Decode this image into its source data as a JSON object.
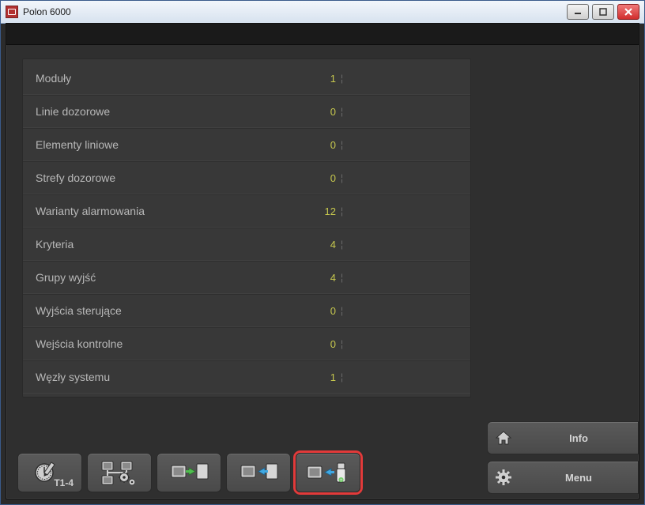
{
  "window": {
    "title": "Polon 6000"
  },
  "list": [
    {
      "label": "Moduły",
      "value": "1"
    },
    {
      "label": "Linie dozorowe",
      "value": "0"
    },
    {
      "label": "Elementy liniowe",
      "value": "0"
    },
    {
      "label": "Strefy dozorowe",
      "value": "0"
    },
    {
      "label": "Warianty alarmowania",
      "value": "12"
    },
    {
      "label": "Kryteria",
      "value": "4"
    },
    {
      "label": "Grupy wyjść",
      "value": "4"
    },
    {
      "label": "Wyjścia sterujące",
      "value": "0"
    },
    {
      "label": "Wejścia kontrolne",
      "value": "0"
    },
    {
      "label": "Węzły systemu",
      "value": "1"
    }
  ],
  "toolbar": {
    "t14_label": "T1-4"
  },
  "side": {
    "info": "Info",
    "menu": "Menu"
  }
}
